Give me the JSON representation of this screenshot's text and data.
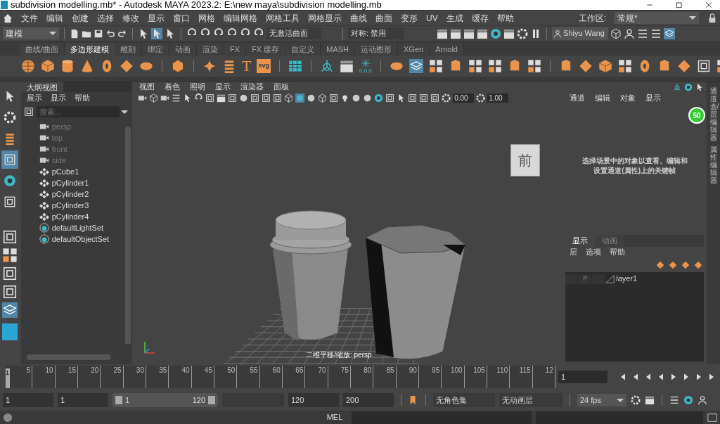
{
  "window": {
    "title": "subdivision modelling.mb* - Autodesk MAYA 2023.2: E:\\new maya\\subdivision modelling.mb"
  },
  "menu": [
    "文件",
    "编辑",
    "创建",
    "选择",
    "修改",
    "显示",
    "窗口",
    "网格",
    "编辑网格",
    "网格工具",
    "网格显示",
    "曲线",
    "曲面",
    "变形",
    "UV",
    "生成",
    "缓存",
    "帮助"
  ],
  "workspace": {
    "label": "工作区:",
    "value": "常规*"
  },
  "status_line": {
    "mode": "建模",
    "live_surface": "无激活曲面",
    "symmetry": "对称: 禁用",
    "user": "Shiyu Wang"
  },
  "shelf_tabs": [
    {
      "label": "曲线/曲面",
      "selected": false
    },
    {
      "label": "多边形建模",
      "selected": true
    },
    {
      "label": "雕刻",
      "selected": false
    },
    {
      "label": "绑定",
      "selected": false
    },
    {
      "label": "动画",
      "selected": false
    },
    {
      "label": "渲染",
      "selected": false
    },
    {
      "label": "FX",
      "selected": false
    },
    {
      "label": "FX 缓存",
      "selected": false
    },
    {
      "label": "自定义",
      "selected": false
    },
    {
      "label": "MASH",
      "selected": false
    },
    {
      "label": "运动图形",
      "selected": false
    },
    {
      "label": "XGen",
      "selected": false
    },
    {
      "label": "Arnold",
      "selected": false
    }
  ],
  "shelf_text_icons": {
    "text_tool": "T",
    "svg_tool": "svg",
    "measure": "0,0,0"
  },
  "toolbox": [
    {
      "selected": false
    },
    {
      "selected": false
    },
    {
      "selected": false
    },
    {
      "selected": true
    },
    {
      "selected": false
    },
    {
      "selected": false
    }
  ],
  "outliner": {
    "title": "大纲视图",
    "menus": [
      "展示",
      "显示",
      "帮助"
    ],
    "search": {
      "placeholder": "搜索..."
    },
    "items": [
      {
        "label": "persp",
        "kind": "camera",
        "dimmed": true
      },
      {
        "label": "top",
        "kind": "camera",
        "dimmed": true
      },
      {
        "label": "front",
        "kind": "camera",
        "dimmed": true
      },
      {
        "label": "side",
        "kind": "camera",
        "dimmed": true
      },
      {
        "label": "pCube1",
        "kind": "mesh",
        "dimmed": false
      },
      {
        "label": "pCylinder1",
        "kind": "mesh",
        "dimmed": false
      },
      {
        "label": "pCylinder2",
        "kind": "mesh",
        "dimmed": false
      },
      {
        "label": "pCylinder3",
        "kind": "mesh",
        "dimmed": false
      },
      {
        "label": "pCylinder4",
        "kind": "mesh",
        "dimmed": false
      },
      {
        "label": "defaultLightSet",
        "kind": "set",
        "dimmed": false
      },
      {
        "label": "defaultObjectSet",
        "kind": "set",
        "dimmed": false
      }
    ]
  },
  "viewport": {
    "menus": [
      "视图",
      "着色",
      "照明",
      "显示",
      "渲染器",
      "面板"
    ],
    "exposure": "0.00",
    "gamma": "1.00",
    "view_cube": "前",
    "camera_label": "二维平移/缩放: persp"
  },
  "channel_box": {
    "menus": [
      "通道",
      "编辑",
      "对象",
      "显示"
    ],
    "message": "选择场景中的对象以查看、编辑和设置通道(属性)上的关键帧"
  },
  "layer_editor": {
    "tabs": [
      {
        "label": "显示",
        "selected": true
      },
      {
        "label": "动画",
        "selected": false
      }
    ],
    "menus": [
      "层",
      "选项",
      "帮助"
    ],
    "layers": [
      {
        "playback": "P",
        "name": "layer1"
      }
    ]
  },
  "side_tabs": [
    "通道盒/层编辑器",
    "属性编辑器"
  ],
  "fps_badge": "50",
  "timeline": {
    "ticks": [
      "5",
      "10",
      "15",
      "20",
      "25",
      "30",
      "35",
      "40",
      "45",
      "50",
      "55",
      "60",
      "65",
      "70",
      "75",
      "80",
      "85",
      "90",
      "95",
      "100",
      "105",
      "110",
      "115",
      "12"
    ],
    "current": "1",
    "current_field": "1",
    "level": 0
  },
  "range": {
    "level": 1,
    "anim_start": "1",
    "start": "1",
    "slider_start": "1",
    "slider_end": "120",
    "end": "120",
    "anim_end": "200",
    "character_set": "无角色集",
    "anim_layer": "无动画层",
    "fps": "24 fps"
  },
  "command_line": {
    "language": "MEL"
  }
}
